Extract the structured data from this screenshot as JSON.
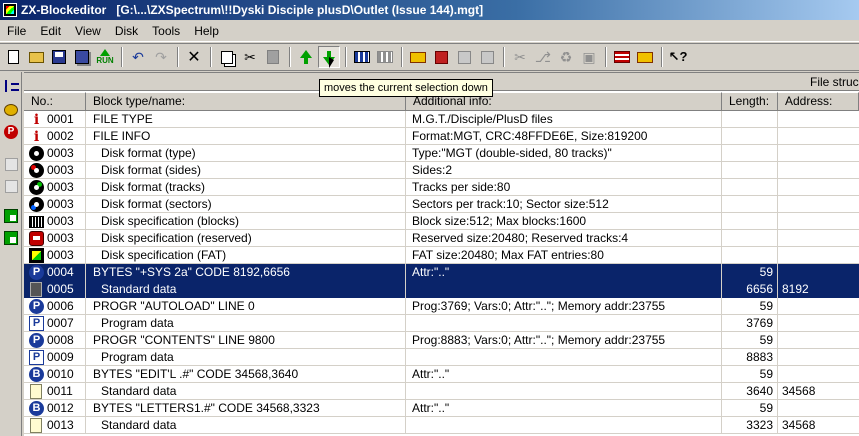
{
  "window": {
    "title": "ZX-Blockeditor   [G:\\...\\ZXSpectrum\\!!Dyski Disciple plusD\\Outlet (Issue 144).mgt]"
  },
  "menu": {
    "items": [
      "File",
      "Edit",
      "View",
      "Disk",
      "Tools",
      "Help"
    ]
  },
  "toolbar": {
    "run_label": "RUN",
    "tooltip": "moves the current selection down"
  },
  "grid": {
    "band_label": "File struc",
    "columns": {
      "no": "No.:",
      "type": "Block type/name:",
      "info": "Additional info:",
      "length": "Length:",
      "address": "Address:"
    },
    "rows": [
      {
        "icon": "info-icon",
        "no": "0001",
        "type": "FILE TYPE",
        "info": "M.G.T./Disciple/PlusD files",
        "length": "",
        "address": "",
        "indent": false,
        "selected": false
      },
      {
        "icon": "info-icon",
        "no": "0002",
        "type": "FILE INFO",
        "info": "Format:MGT,  CRC:48FFDE6E,  Size:819200",
        "length": "",
        "address": "",
        "indent": false,
        "selected": false
      },
      {
        "icon": "disk-icon",
        "no": "0003",
        "type": "Disk format (type)",
        "info": "Type:\"MGT (double-sided, 80 tracks)\"",
        "length": "",
        "address": "",
        "indent": true,
        "selected": false
      },
      {
        "icon": "disk-red-icon",
        "no": "0003",
        "type": "Disk format (sides)",
        "info": "Sides:2",
        "length": "",
        "address": "",
        "indent": true,
        "selected": false
      },
      {
        "icon": "disk-green-icon",
        "no": "0003",
        "type": "Disk format (tracks)",
        "info": "Tracks per side:80",
        "length": "",
        "address": "",
        "indent": true,
        "selected": false
      },
      {
        "icon": "disk-blue-icon",
        "no": "0003",
        "type": "Disk format (sectors)",
        "info": "Sectors per track:10;  Sector size:512",
        "length": "",
        "address": "",
        "indent": true,
        "selected": false
      },
      {
        "icon": "blocks-icon",
        "no": "0003",
        "type": "Disk specification (blocks)",
        "info": "Block size:512;  Max blocks:1600",
        "length": "",
        "address": "",
        "indent": true,
        "selected": false
      },
      {
        "icon": "reserved-icon",
        "no": "0003",
        "type": "Disk specification (reserved)",
        "info": "Reserved size:20480;  Reserved tracks:4",
        "length": "",
        "address": "",
        "indent": true,
        "selected": false
      },
      {
        "icon": "fat-icon",
        "no": "0003",
        "type": "Disk specification (FAT)",
        "info": "FAT size:20480;  Max FAT entries:80",
        "length": "",
        "address": "",
        "indent": true,
        "selected": false
      },
      {
        "icon": "p-icon",
        "no": "0004",
        "type": "BYTES \"+SYS 2a\" CODE 8192,6656",
        "info": "Attr:\"..\"",
        "length": "59",
        "address": "",
        "indent": false,
        "selected": true
      },
      {
        "icon": "doc-dark-icon",
        "no": "0005",
        "type": "Standard data",
        "info": "",
        "length": "6656",
        "address": "8192",
        "indent": true,
        "selected": true
      },
      {
        "icon": "p-icon",
        "no": "0006",
        "type": "PROGR \"AUTOLOAD\" LINE 0",
        "info": "Prog:3769;  Vars:0;  Attr:\"..\";  Memory addr:23755",
        "length": "59",
        "address": "",
        "indent": false,
        "selected": false
      },
      {
        "icon": "p-square-icon",
        "no": "0007",
        "type": "Program data",
        "info": "",
        "length": "3769",
        "address": "",
        "indent": true,
        "selected": false
      },
      {
        "icon": "p-icon",
        "no": "0008",
        "type": "PROGR \"CONTENTS\" LINE 9800",
        "info": "Prog:8883;  Vars:0;  Attr:\"..\";  Memory addr:23755",
        "length": "59",
        "address": "",
        "indent": false,
        "selected": false
      },
      {
        "icon": "p-square-icon",
        "no": "0009",
        "type": "Program data",
        "info": "",
        "length": "8883",
        "address": "",
        "indent": true,
        "selected": false
      },
      {
        "icon": "b-icon",
        "no": "0010",
        "type": "BYTES \"EDIT'L .#\" CODE 34568,3640",
        "info": "Attr:\"..\"",
        "length": "59",
        "address": "",
        "indent": false,
        "selected": false
      },
      {
        "icon": "doc-icon",
        "no": "0011",
        "type": "Standard data",
        "info": "",
        "length": "3640",
        "address": "34568",
        "indent": true,
        "selected": false
      },
      {
        "icon": "b-icon",
        "no": "0012",
        "type": "BYTES \"LETTERS1.#\" CODE 34568,3323",
        "info": "Attr:\"..\"",
        "length": "59",
        "address": "",
        "indent": false,
        "selected": false
      },
      {
        "icon": "doc-icon",
        "no": "0013",
        "type": "Standard data",
        "info": "",
        "length": "3323",
        "address": "34568",
        "indent": true,
        "selected": false
      }
    ]
  }
}
